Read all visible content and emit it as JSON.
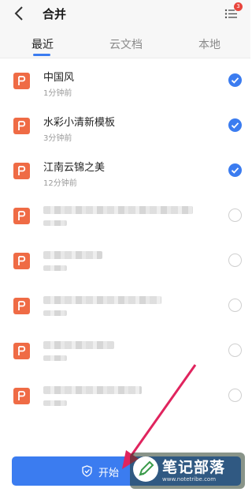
{
  "header": {
    "title": "合并",
    "menu_badge": "3"
  },
  "tabs": [
    {
      "label": "最近",
      "active": true
    },
    {
      "label": "云文档",
      "active": false
    },
    {
      "label": "本地",
      "active": false
    }
  ],
  "files": [
    {
      "name": "中国风",
      "time": "1分钟前",
      "selected": true,
      "icon": "ppt-file-icon"
    },
    {
      "name": "水彩小清新模板",
      "time": "3分钟前",
      "selected": true,
      "icon": "ppt-file-icon"
    },
    {
      "name": "江南云锦之美",
      "time": "12分钟前",
      "selected": true,
      "icon": "ppt-file-icon"
    },
    {
      "name": "",
      "time": "",
      "selected": false,
      "icon": "ppt-file-icon",
      "blurred": true
    },
    {
      "name": "",
      "time": "",
      "selected": false,
      "icon": "ppt-file-icon",
      "blurred": true
    },
    {
      "name": "",
      "time": "",
      "selected": false,
      "icon": "ppt-file-icon",
      "blurred": true
    },
    {
      "name": "",
      "time": "",
      "selected": false,
      "icon": "ppt-file-icon",
      "blurred": true
    },
    {
      "name": "",
      "time": "",
      "selected": false,
      "icon": "ppt-file-icon",
      "blurred": true
    }
  ],
  "bottom": {
    "start_label": "开始"
  },
  "watermark": {
    "text": "笔记部落",
    "url": "www.notetribe.com"
  },
  "colors": {
    "accent": "#3b7cf0",
    "file_icon": "#ef6b45",
    "arrow": "#e0245e"
  }
}
